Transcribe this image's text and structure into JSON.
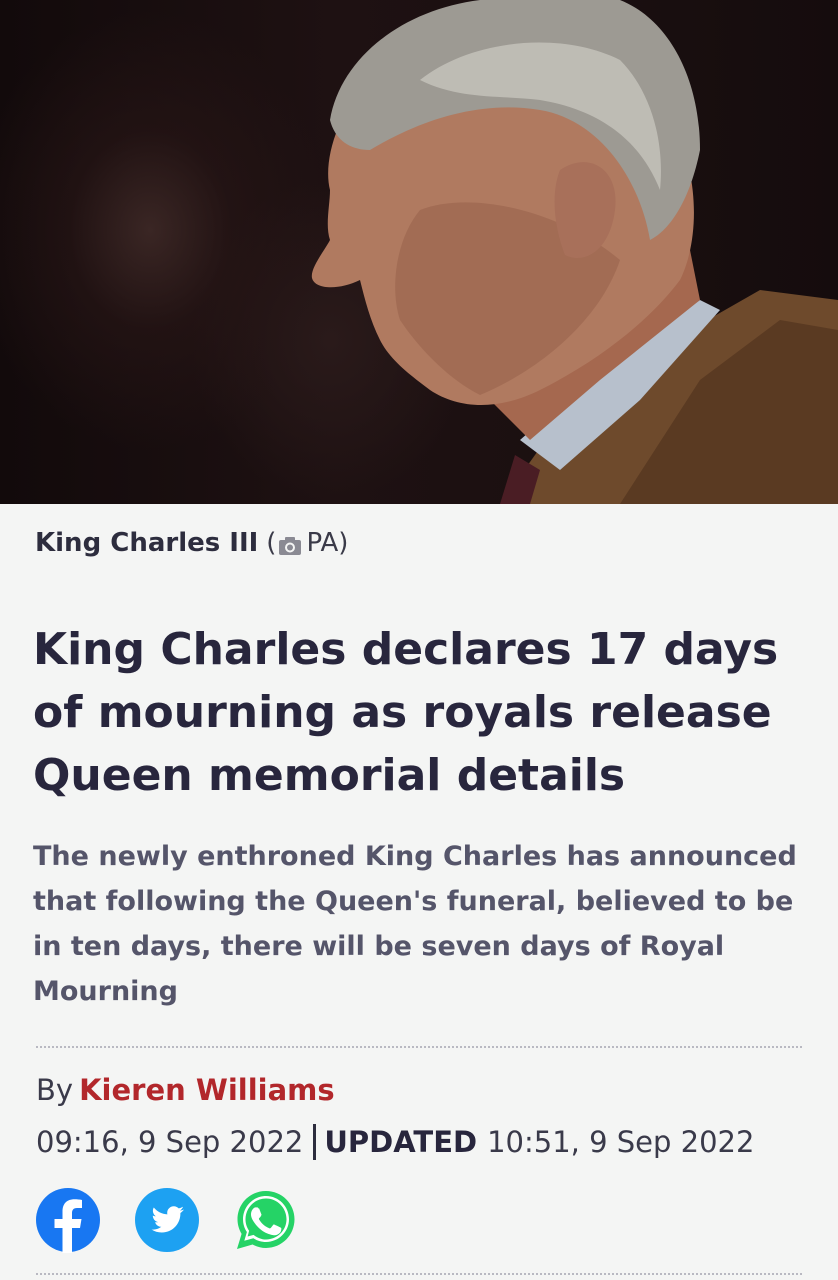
{
  "hero": {
    "image_icon": "portrait-photo"
  },
  "caption": {
    "name": "King Charles III",
    "open_paren": "(",
    "camera_icon": "camera-icon",
    "credit": "PA)"
  },
  "article": {
    "headline": "King Charles declares 17 days of mourning as royals release Queen memorial details",
    "standfirst": "The newly enthroned King Charles has announced that following the Queen's funeral, believed to be in ten days, there will be seven days of Royal Mourning"
  },
  "byline": {
    "prefix": "By",
    "author": "Kieren Williams"
  },
  "dates": {
    "published": "09:16, 9 Sep 2022",
    "updated_label": "UPDATED",
    "updated": "10:51, 9 Sep 2022"
  },
  "share": {
    "facebook_icon": "facebook-icon",
    "twitter_icon": "twitter-icon",
    "whatsapp_icon": "whatsapp-icon"
  },
  "colors": {
    "author": "#b2272b",
    "headline": "#28263d",
    "facebook": "#1877f2",
    "twitter": "#1da1f2",
    "whatsapp": "#25d366"
  }
}
